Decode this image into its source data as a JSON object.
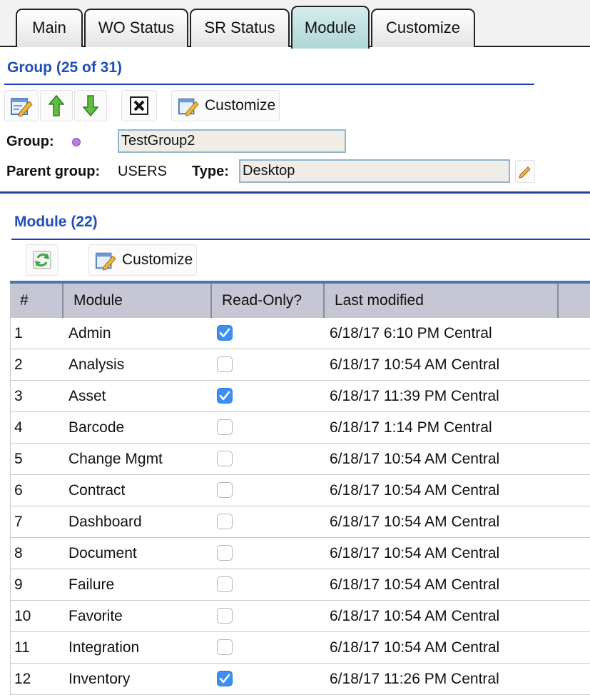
{
  "tabs": [
    "Main",
    "WO Status",
    "SR Status",
    "Module",
    "Customize"
  ],
  "active_tab": "Module",
  "group_section": {
    "title": "Group (25 of 31)",
    "customize_label": "Customize",
    "group_label": "Group:",
    "group_value": "TestGroup2",
    "parent_label": "Parent group:",
    "parent_value": "USERS",
    "type_label": "Type:",
    "type_value": "Desktop"
  },
  "module_section": {
    "title": "Module (22)",
    "customize_label": "Customize",
    "columns": [
      "#",
      "Module",
      "Read-Only?",
      "Last modified"
    ],
    "rows": [
      {
        "num": "1",
        "module": "Admin",
        "readonly": true,
        "modified": "6/18/17 6:10 PM Central"
      },
      {
        "num": "2",
        "module": "Analysis",
        "readonly": false,
        "modified": "6/18/17 10:54 AM Central"
      },
      {
        "num": "3",
        "module": "Asset",
        "readonly": true,
        "modified": "6/18/17 11:39 PM Central"
      },
      {
        "num": "4",
        "module": "Barcode",
        "readonly": false,
        "modified": "6/18/17 1:14 PM Central"
      },
      {
        "num": "5",
        "module": "Change Mgmt",
        "readonly": false,
        "modified": "6/18/17 10:54 AM Central"
      },
      {
        "num": "6",
        "module": "Contract",
        "readonly": false,
        "modified": "6/18/17 10:54 AM Central"
      },
      {
        "num": "7",
        "module": "Dashboard",
        "readonly": false,
        "modified": "6/18/17 10:54 AM Central"
      },
      {
        "num": "8",
        "module": "Document",
        "readonly": false,
        "modified": "6/18/17 10:54 AM Central"
      },
      {
        "num": "9",
        "module": "Failure",
        "readonly": false,
        "modified": "6/18/17 10:54 AM Central"
      },
      {
        "num": "10",
        "module": "Favorite",
        "readonly": false,
        "modified": "6/18/17 10:54 AM Central"
      },
      {
        "num": "11",
        "module": "Integration",
        "readonly": false,
        "modified": "6/18/17 10:54 AM Central"
      },
      {
        "num": "12",
        "module": "Inventory",
        "readonly": true,
        "modified": "6/18/17 11:26 PM Central"
      }
    ]
  },
  "colors": {
    "accent": "#1f4fb7",
    "checkbox_on": "#3b8ef3",
    "active_tab": "#aed6d6"
  },
  "icons": [
    "edit-icon",
    "arrow-up-icon",
    "arrow-down-icon",
    "delete-icon",
    "customize-icon",
    "refresh-icon"
  ]
}
